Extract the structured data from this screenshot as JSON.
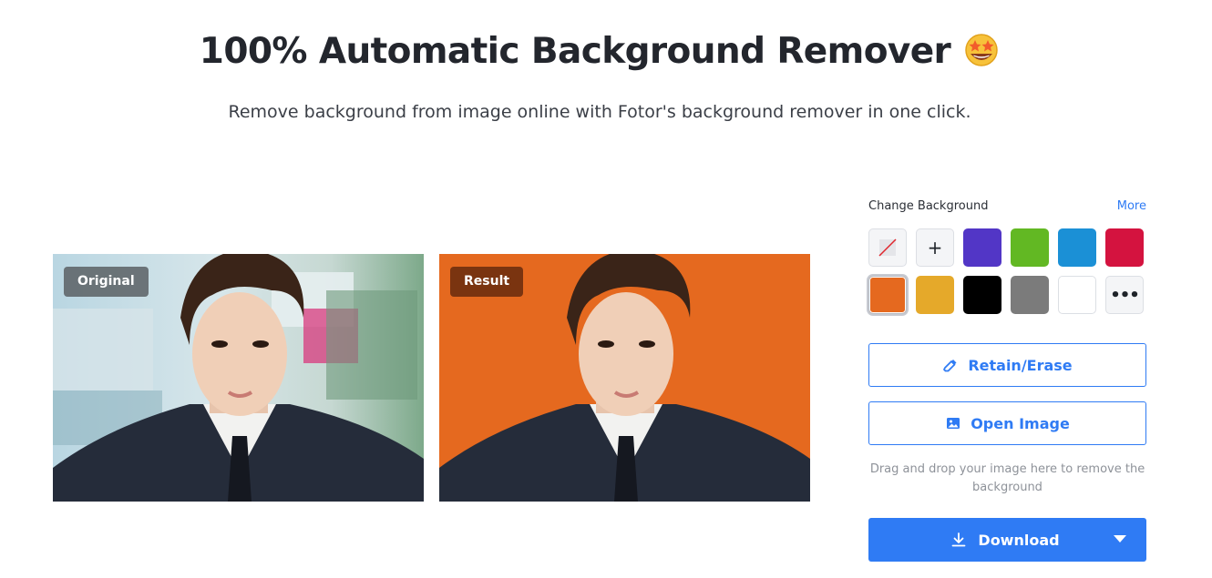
{
  "header": {
    "title": "100% Automatic Background Remover",
    "emoji": "star-struck-emoji",
    "subtitle": "Remove background from image online with Fotor's background remover in one click."
  },
  "preview": {
    "original_label": "Original",
    "result_label": "Result",
    "result_background": "#e5691f"
  },
  "sidebar": {
    "change_bg_label": "Change Background",
    "more_label": "More",
    "swatches": [
      {
        "kind": "none",
        "icon": "no-color-icon"
      },
      {
        "kind": "add",
        "icon": "plus-icon"
      },
      {
        "kind": "color",
        "color": "#5236c6"
      },
      {
        "kind": "color",
        "color": "#62b823"
      },
      {
        "kind": "color",
        "color": "#1b90d6"
      },
      {
        "kind": "color",
        "color": "#d4133f"
      },
      {
        "kind": "color",
        "color": "#e5691f",
        "selected": true
      },
      {
        "kind": "color",
        "color": "#e5a92a"
      },
      {
        "kind": "color",
        "color": "#000000"
      },
      {
        "kind": "color",
        "color": "#7b7b7b"
      },
      {
        "kind": "color",
        "color": "#ffffff"
      },
      {
        "kind": "more",
        "icon": "ellipsis-icon"
      }
    ],
    "retain_label": "Retain/Erase",
    "open_label": "Open Image",
    "hint": "Drag and drop your image here to remove the background",
    "download_label": "Download"
  },
  "colors": {
    "accent": "#2f7bf4"
  }
}
